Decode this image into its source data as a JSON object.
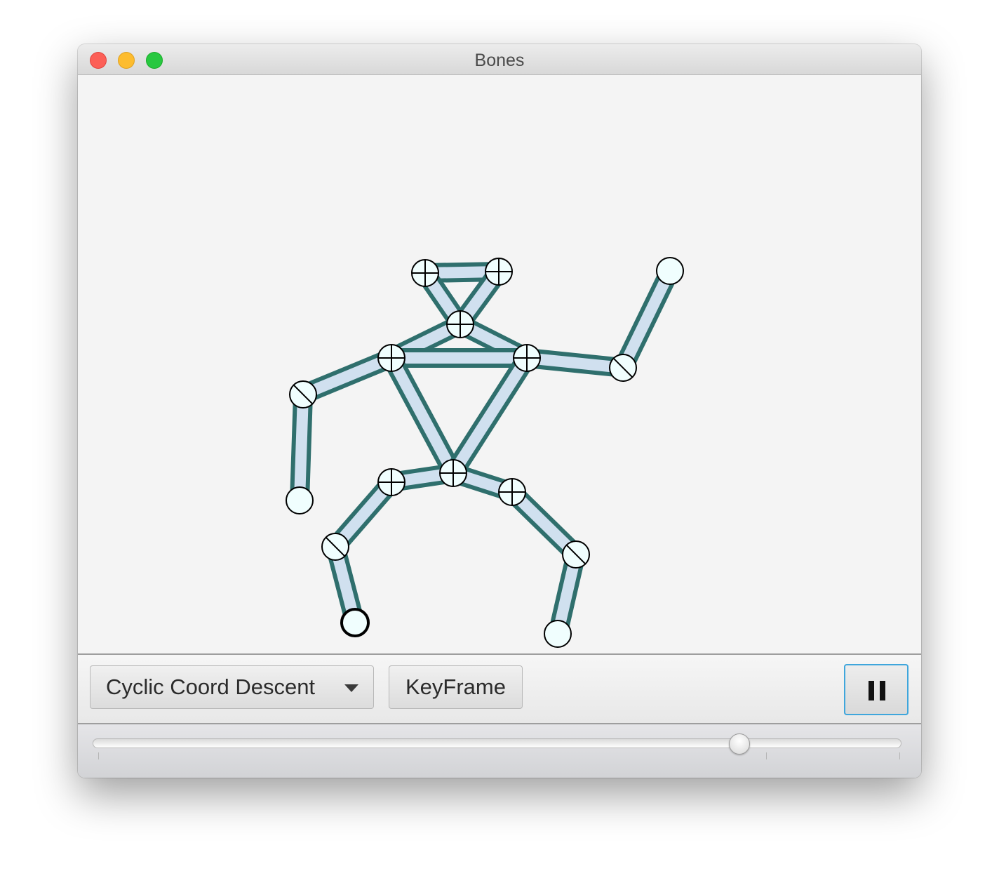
{
  "window": {
    "title": "Bones"
  },
  "toolbar": {
    "solver_select": {
      "selected": "Cyclic Coord Descent"
    },
    "keyframe_label": "KeyFrame",
    "pause_icon": "pause-icon"
  },
  "slider": {
    "value_fraction": 0.8
  },
  "skeleton": {
    "bone_color": "#2f6f6d",
    "bone_fill": "#d0e0ef",
    "joint_fill": "#f0fefe",
    "joints": [
      {
        "id": "head-left",
        "type": "cross"
      },
      {
        "id": "head-right",
        "type": "cross"
      },
      {
        "id": "neck",
        "type": "cross"
      },
      {
        "id": "shoulder-left",
        "type": "cross"
      },
      {
        "id": "shoulder-right",
        "type": "cross"
      },
      {
        "id": "elbow-left",
        "type": "hinge"
      },
      {
        "id": "hand-left",
        "type": "end"
      },
      {
        "id": "elbow-right",
        "type": "hinge"
      },
      {
        "id": "hand-right",
        "type": "end"
      },
      {
        "id": "pelvis",
        "type": "cross"
      },
      {
        "id": "hip-left",
        "type": "cross"
      },
      {
        "id": "hip-right",
        "type": "cross"
      },
      {
        "id": "knee-left",
        "type": "hinge"
      },
      {
        "id": "foot-left",
        "type": "end-selected"
      },
      {
        "id": "knee-right",
        "type": "hinge"
      },
      {
        "id": "foot-right",
        "type": "end"
      }
    ],
    "bones": [
      [
        "head-left",
        "head-right"
      ],
      [
        "head-left",
        "neck"
      ],
      [
        "head-right",
        "neck"
      ],
      [
        "neck",
        "shoulder-left"
      ],
      [
        "neck",
        "shoulder-right"
      ],
      [
        "shoulder-left",
        "shoulder-right"
      ],
      [
        "shoulder-left",
        "elbow-left"
      ],
      [
        "elbow-left",
        "hand-left"
      ],
      [
        "shoulder-right",
        "elbow-right"
      ],
      [
        "elbow-right",
        "hand-right"
      ],
      [
        "shoulder-left",
        "pelvis"
      ],
      [
        "shoulder-right",
        "pelvis"
      ],
      [
        "pelvis",
        "hip-left"
      ],
      [
        "pelvis",
        "hip-right"
      ],
      [
        "hip-left",
        "knee-left"
      ],
      [
        "knee-left",
        "foot-left"
      ],
      [
        "hip-right",
        "knee-right"
      ],
      [
        "knee-right",
        "foot-right"
      ]
    ]
  }
}
